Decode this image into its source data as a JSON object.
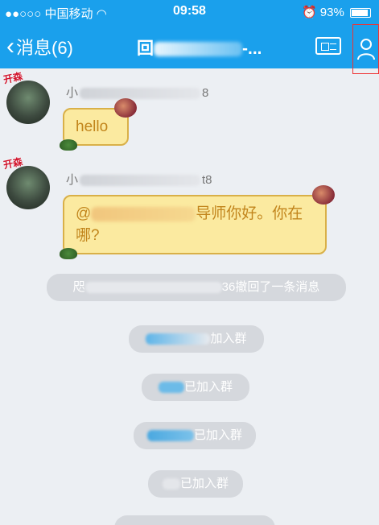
{
  "status_bar": {
    "carrier": "●●○○○ 中国移动",
    "time": "09:58",
    "battery": "93%"
  },
  "nav": {
    "back_label": "消息(6)",
    "title_prefix": "回",
    "title_suffix": "-..."
  },
  "messages": [
    {
      "avatar_tag": "开森",
      "sender_prefix": "小",
      "sender_suffix": "8",
      "text": "hello"
    },
    {
      "avatar_tag": "开森",
      "sender_prefix": "小",
      "sender_suffix": "t8",
      "text_prefix": "@",
      "text_line1_suffix": "导师你好。你在",
      "text_line2": "哪?"
    }
  ],
  "notices": {
    "recall": {
      "prefix": "咫",
      "suffix": "36撤回了一条消息"
    },
    "join1": {
      "suffix": "加入群"
    },
    "join2": {
      "suffix": "已加入群"
    },
    "join3": {
      "suffix": "已加入群"
    },
    "join4": {
      "suffix": "已加入群"
    }
  },
  "colors": {
    "header": "#1aa0ec",
    "bubble_fill": "#fbeaa0",
    "bubble_text": "#c2851c",
    "notice_bg": "#d5d8dd"
  }
}
